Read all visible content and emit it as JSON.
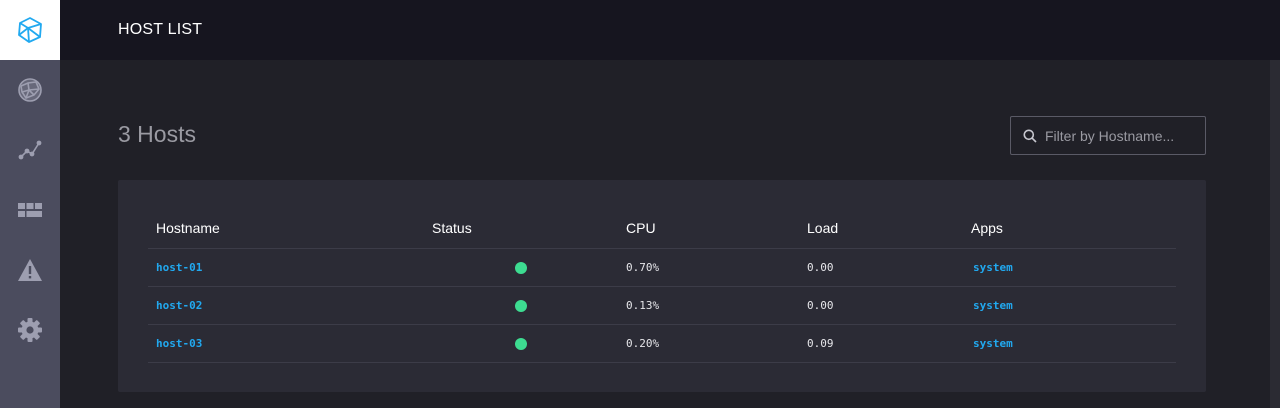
{
  "header": {
    "title": "HOST LIST"
  },
  "sidebar": {
    "logo_icon": "polyhedron-logo-icon",
    "items": [
      {
        "icon": "network-globe-icon"
      },
      {
        "icon": "graph-path-icon"
      },
      {
        "icon": "grid-blocks-icon"
      },
      {
        "icon": "warning-triangle-icon"
      },
      {
        "icon": "gear-icon"
      }
    ]
  },
  "main": {
    "title": "3 Hosts",
    "filter": {
      "placeholder": "Filter by Hostname...",
      "value": ""
    }
  },
  "table": {
    "columns": [
      "Hostname",
      "Status",
      "CPU",
      "Load",
      "Apps"
    ],
    "rows": [
      {
        "hostname": "host-01",
        "status": "healthy",
        "cpu": "0.70%",
        "load": "0.00",
        "apps": "system"
      },
      {
        "hostname": "host-02",
        "status": "healthy",
        "cpu": "0.13%",
        "load": "0.00",
        "apps": "system"
      },
      {
        "hostname": "host-03",
        "status": "healthy",
        "cpu": "0.20%",
        "load": "0.09",
        "apps": "system"
      }
    ]
  },
  "colors": {
    "accent": "#21a9f0",
    "status_healthy": "#3ddc91",
    "sidebar_bg": "#4b4c5e",
    "header_bg": "#16151f",
    "main_bg": "#202027",
    "panel_bg": "#2b2b35"
  }
}
